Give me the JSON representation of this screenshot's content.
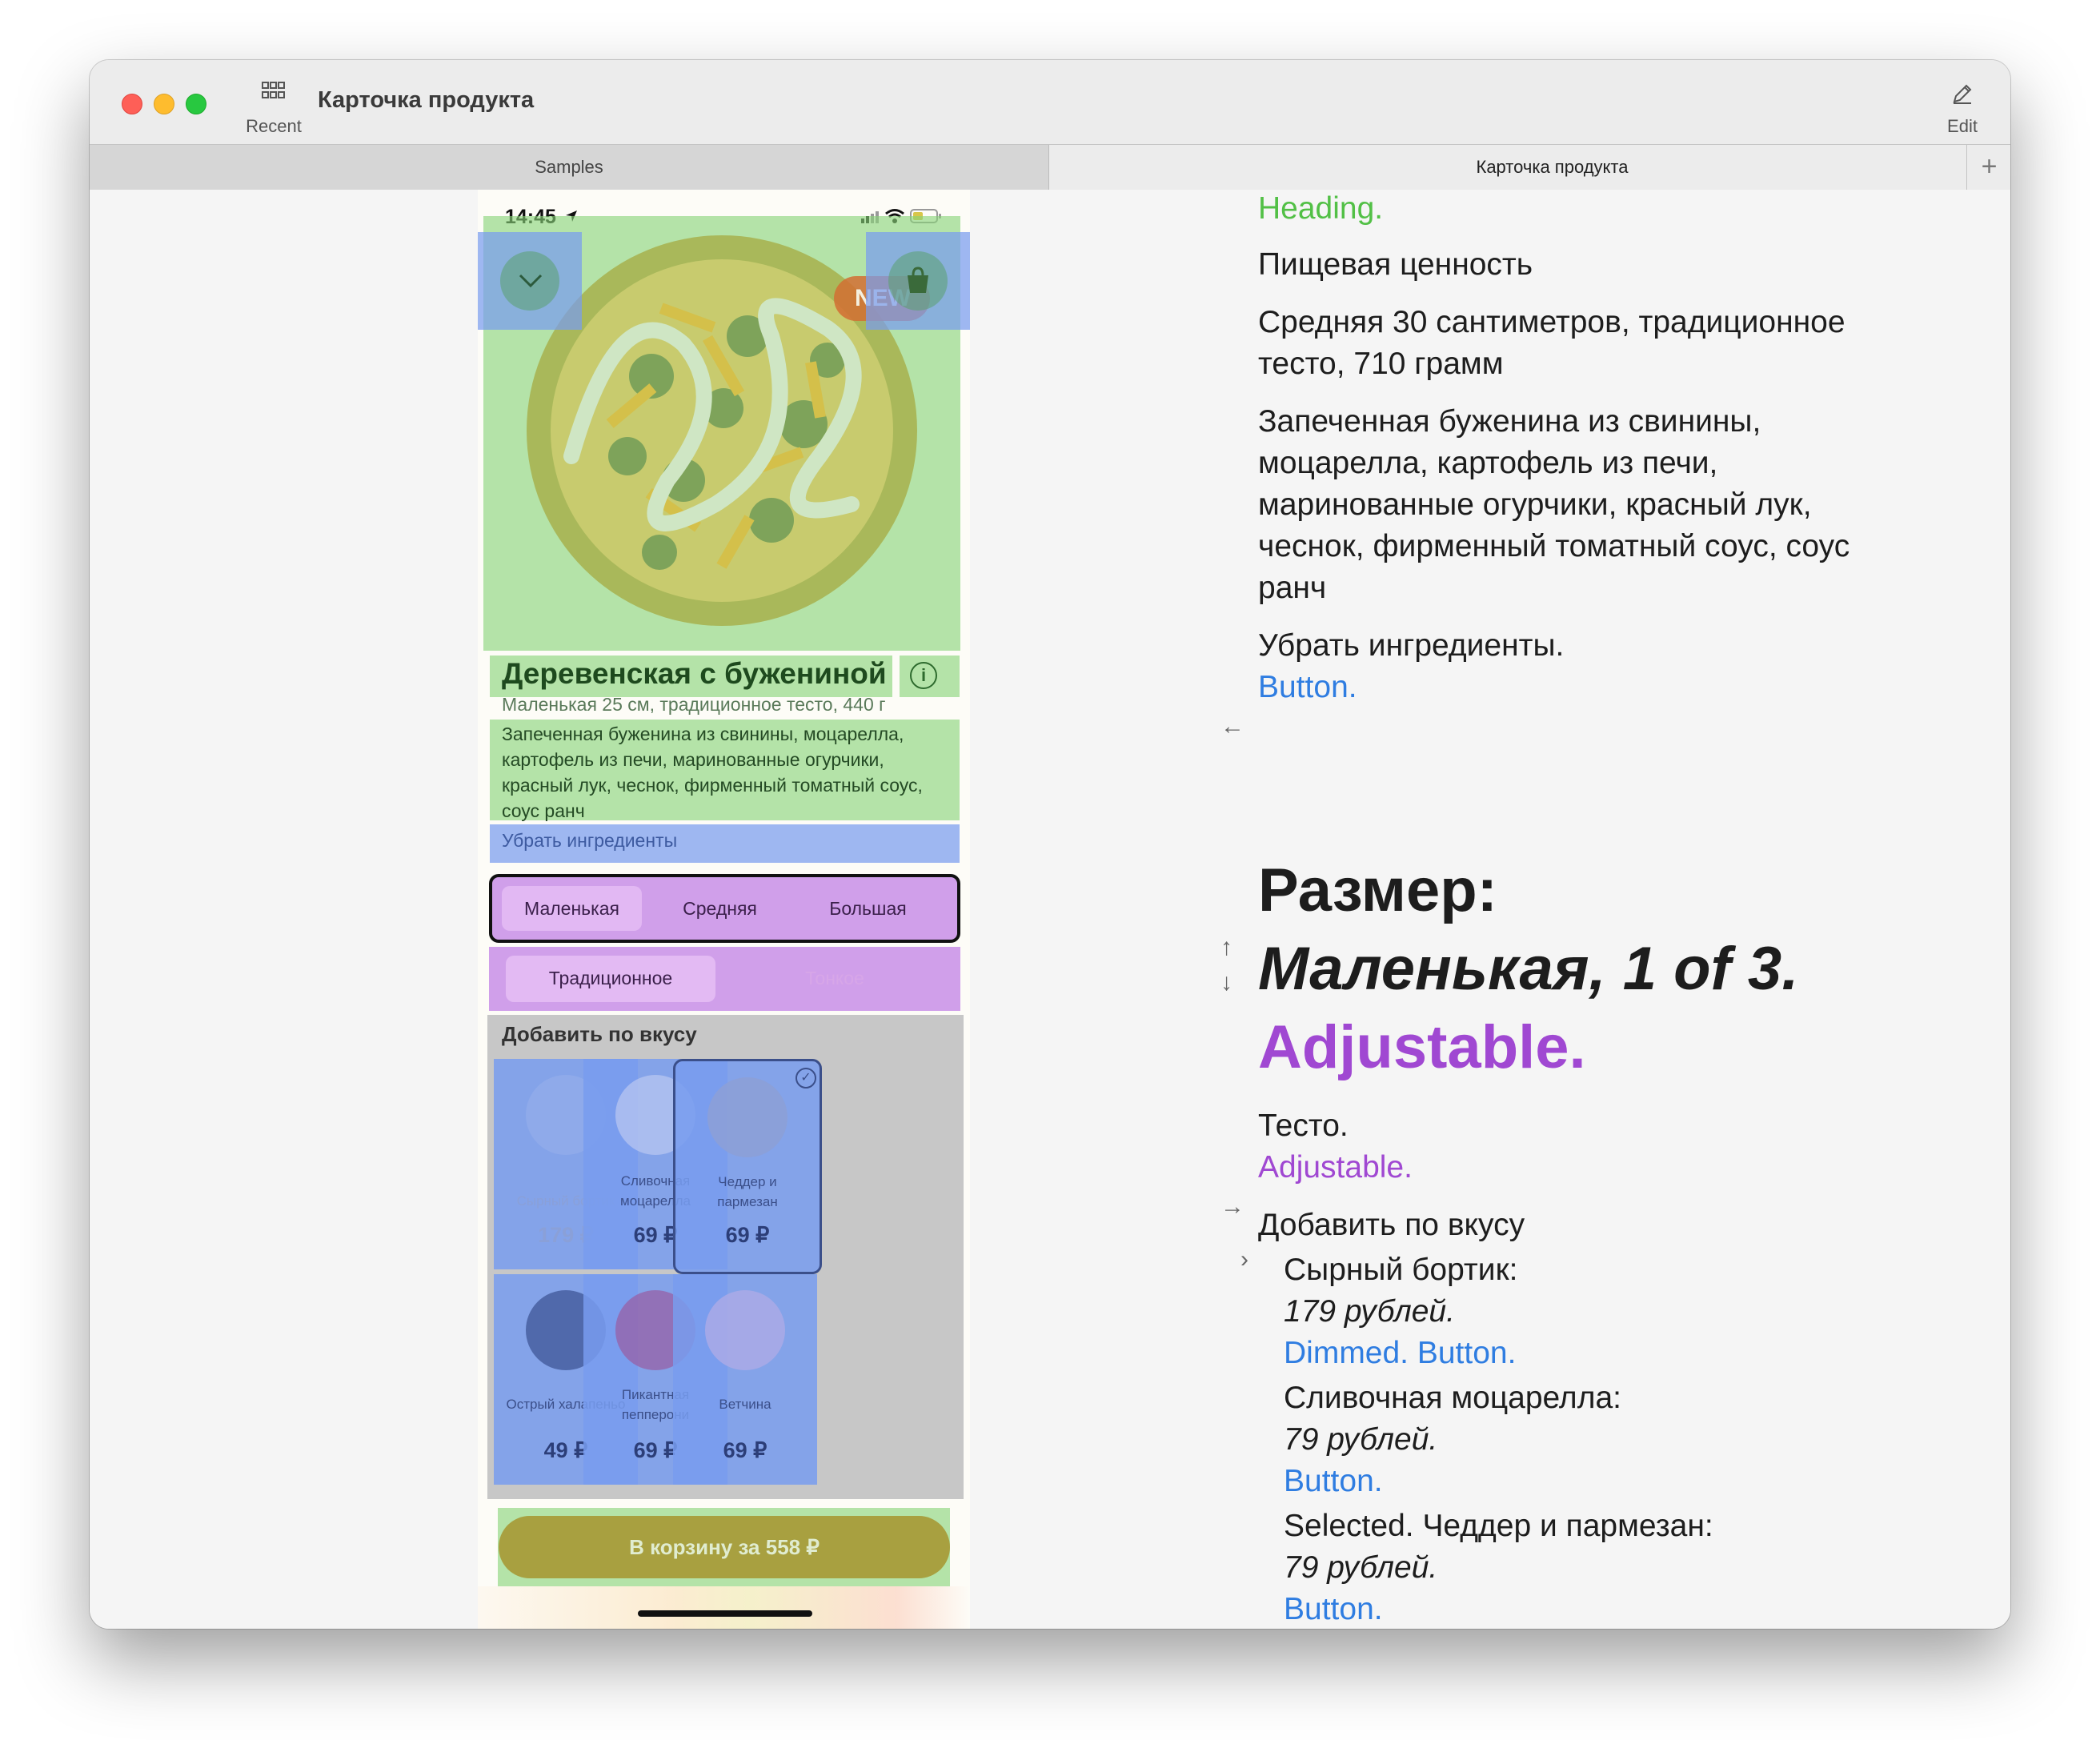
{
  "window": {
    "title": "Карточка продукта",
    "recent_label": "Recent",
    "edit_label": "Edit"
  },
  "tabs": [
    {
      "label": "Samples",
      "active": false
    },
    {
      "label": "Карточка продукта",
      "active": true
    }
  ],
  "tab_add": "+",
  "phone": {
    "status_time": "14:45",
    "new_badge": "NEW",
    "product_title": "Деревенская с бужениной",
    "product_subtitle": "Маленькая 25 см, традиционное тесто, 440 г",
    "product_description": "Запеченная буженина из свинины, моцарелла, картофель из печи, маринованные огурчики, красный лук, чеснок, фирменный томатный соус, соус ранч",
    "remove_ingredients": "Убрать ингредиенты",
    "sizes": {
      "options": [
        "Маленькая",
        "Средняя",
        "Большая"
      ],
      "selected": "Маленькая"
    },
    "dough": {
      "options": [
        "Традиционное",
        "Тонкое"
      ],
      "selected": "Традиционное"
    },
    "addons_title": "Добавить по вкусу",
    "addons": [
      {
        "name": "Сырный бортик",
        "price": "179 ₽",
        "dimmed": true,
        "selected": false
      },
      {
        "name": "Сливочная моцарелла",
        "price": "69 ₽",
        "dimmed": false,
        "selected": false
      },
      {
        "name": "Чеддер и пармезан",
        "price": "69 ₽",
        "dimmed": false,
        "selected": true
      },
      {
        "name": "Острый халапеньо",
        "price": "49 ₽",
        "dimmed": false,
        "selected": false
      },
      {
        "name": "Пикантная пепперони",
        "price": "69 ₽",
        "dimmed": false,
        "selected": false
      },
      {
        "name": "Ветчина",
        "price": "69 ₽",
        "dimmed": false,
        "selected": false
      }
    ],
    "cart_button": "В корзину за 558 ₽"
  },
  "voiceover": {
    "heading_trait": "Heading.",
    "nutrition": "Пищевая ценность",
    "size_info": [
      "Средняя 30 сантиметров, традиционное",
      "тесто, 710 грамм"
    ],
    "ingredients": [
      "Запеченная буженина из свинины,",
      "моцарелла, картофель из печи,",
      "маринованные огурчики, красный лук,",
      "чеснок, фирменный томатный соус, соус",
      "ранч"
    ],
    "remove_label": "Убрать ингредиенты.",
    "button_trait": "Button.",
    "size_heading": "Размер:",
    "size_value": "Маленькая, 1 of 3.",
    "adjustable_trait": "Adjustable.",
    "dough_label": "Тесто.",
    "addons_label": "Добавить по вкусу",
    "addon_items": [
      {
        "name": "Сырный бортик:",
        "price": "179 рублей",
        "trait": "Dimmed. Button."
      },
      {
        "name": "Сливочная моцарелла:",
        "price": "79 рублей",
        "trait": "Button."
      },
      {
        "name": "Selected. Чеддер и пармезан:",
        "price": "79 рублей",
        "trait": "Button."
      }
    ]
  },
  "colors": {
    "heading_green": "#52c046",
    "button_blue": "#2f7de1",
    "adjustable_purple": "#a048d2",
    "cart_button": "#a8a040"
  }
}
